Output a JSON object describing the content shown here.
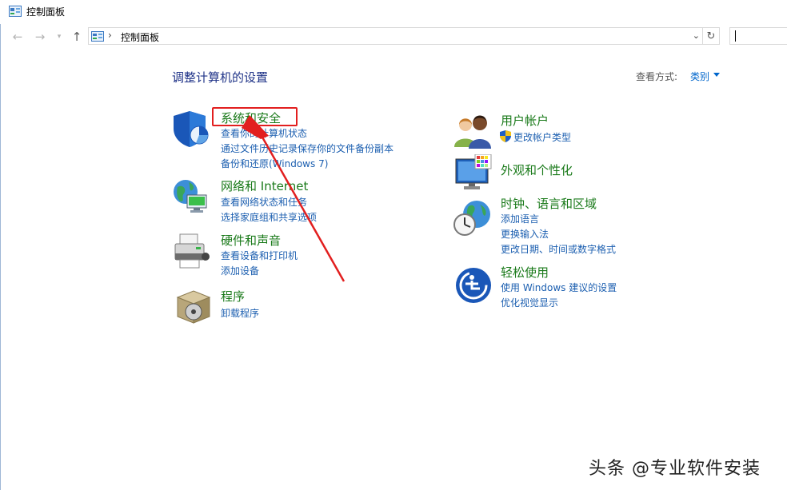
{
  "window": {
    "title": "控制面板"
  },
  "address_bar": {
    "crumb": "控制面板",
    "search_value": ""
  },
  "header": {
    "title": "调整计算机的设置",
    "view_by_label": "查看方式:",
    "view_by_value": "类别"
  },
  "categories_left": [
    {
      "title": "系统和安全",
      "links": [
        "查看你的计算机状态",
        "通过文件历史记录保存你的文件备份副本",
        "备份和还原(Windows 7)"
      ]
    },
    {
      "title": "网络和 Internet",
      "links": [
        "查看网络状态和任务",
        "选择家庭组和共享选项"
      ]
    },
    {
      "title": "硬件和声音",
      "links": [
        "查看设备和打印机",
        "添加设备"
      ]
    },
    {
      "title": "程序",
      "links": [
        "卸载程序"
      ]
    }
  ],
  "categories_right": [
    {
      "title": "用户帐户",
      "links": [
        "更改帐户类型"
      ]
    },
    {
      "title": "外观和个性化",
      "links": []
    },
    {
      "title": "时钟、语言和区域",
      "links": [
        "添加语言",
        "更换输入法",
        "更改日期、时间或数字格式"
      ]
    },
    {
      "title": "轻松使用",
      "links": [
        "使用 Windows 建议的设置",
        "优化视觉显示"
      ]
    }
  ],
  "annotation": {
    "highlight_color": "#e21f1f"
  },
  "watermark": "头条 @专业软件安装"
}
